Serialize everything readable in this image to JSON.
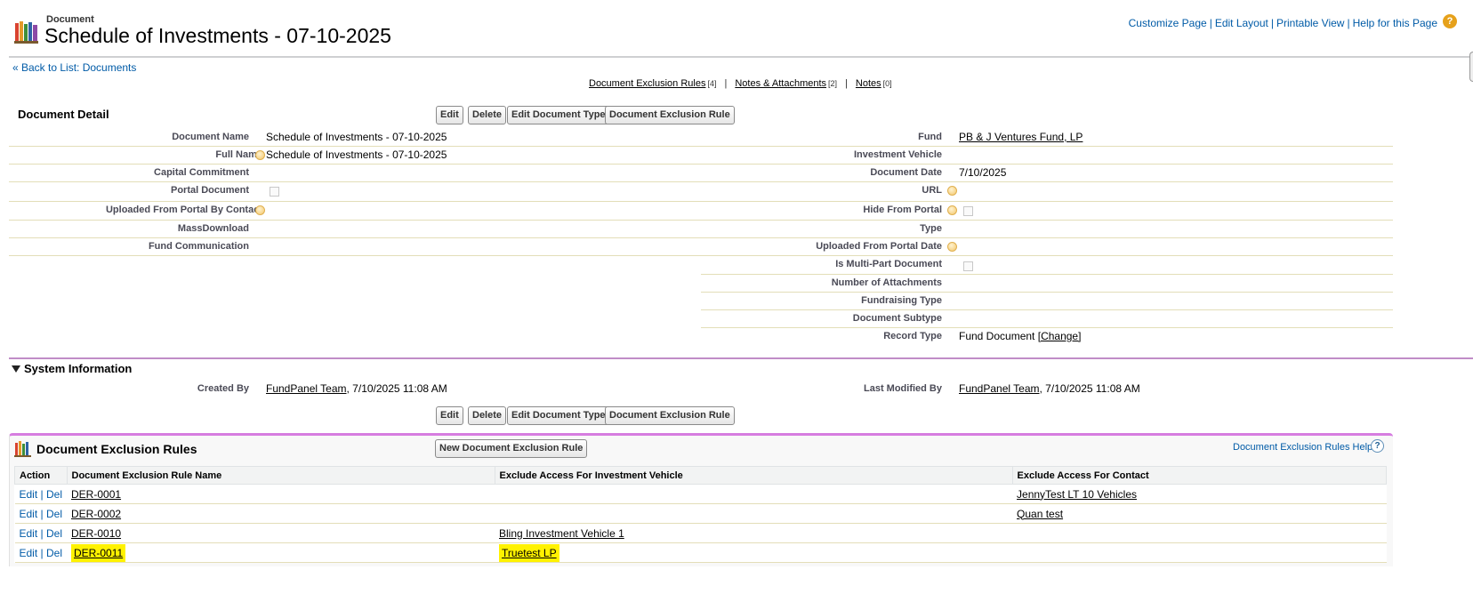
{
  "header": {
    "object_type": "Document",
    "title": "Schedule of Investments - 07-10-2025",
    "links": [
      "Customize Page",
      "Edit Layout",
      "Printable View",
      "Help for this Page"
    ]
  },
  "back_link": "« Back to List: Documents",
  "related_links": [
    {
      "label": "Document Exclusion Rules",
      "count": "[4]"
    },
    {
      "label": "Notes & Attachments",
      "count": "[2]"
    },
    {
      "label": "Notes",
      "count": "[0]"
    }
  ],
  "detail": {
    "section_title": "Document Detail",
    "buttons": [
      "Edit",
      "Delete",
      "Edit Document Type",
      "Document Exclusion Rule"
    ],
    "left": [
      {
        "label": "Document Name",
        "value": "Schedule of Investments - 07-10-2025"
      },
      {
        "label": "Full Name",
        "value": "Schedule of Investments - 07-10-2025"
      },
      {
        "label": "Capital Commitment",
        "value": ""
      },
      {
        "label": "Portal Document",
        "value": ""
      },
      {
        "label": "Uploaded From Portal By Contact",
        "value": ""
      },
      {
        "label": "MassDownload",
        "value": ""
      },
      {
        "label": "Fund Communication",
        "value": ""
      }
    ],
    "right": [
      {
        "label": "Fund",
        "value": "PB & J Ventures Fund, LP"
      },
      {
        "label": "Investment Vehicle",
        "value": ""
      },
      {
        "label": "Document Date",
        "value": "7/10/2025"
      },
      {
        "label": "URL",
        "value": ""
      },
      {
        "label": "Hide From Portal",
        "value": ""
      },
      {
        "label": "Type",
        "value": ""
      },
      {
        "label": "Uploaded From Portal Date",
        "value": ""
      },
      {
        "label": "Is Multi-Part Document",
        "value": ""
      },
      {
        "label": "Number of Attachments",
        "value": ""
      },
      {
        "label": "Fundraising Type",
        "value": ""
      },
      {
        "label": "Document Subtype",
        "value": ""
      },
      {
        "label": "Record Type",
        "value": "Fund Document",
        "action": "[Change]"
      }
    ]
  },
  "system": {
    "title": "System Information",
    "created_by_label": "Created By",
    "created_by_user": "FundPanel Team",
    "created_by_date": ", 7/10/2025 11:08 AM",
    "modified_by_label": "Last Modified By",
    "modified_by_user": "FundPanel Team",
    "modified_by_date": ", 7/10/2025 11:08 AM"
  },
  "exclusion_rules": {
    "title": "Document Exclusion Rules",
    "new_button": "New Document Exclusion Rule",
    "help": "Document Exclusion Rules Help",
    "columns": [
      "Action",
      "Document Exclusion Rule Name",
      "Exclude Access For Investment Vehicle",
      "Exclude Access For Contact"
    ],
    "action_edit": "Edit",
    "action_sep": "|",
    "action_del": "Del",
    "rows": [
      {
        "name": "DER-0001",
        "vehicle": "",
        "contact": "JennyTest LT 10 Vehicles",
        "highlight": false
      },
      {
        "name": "DER-0002",
        "vehicle": "",
        "contact": "Quan test",
        "highlight": false
      },
      {
        "name": "DER-0010",
        "vehicle": "Bling Investment Vehicle 1",
        "contact": "",
        "highlight": false
      },
      {
        "name": "DER-0011",
        "vehicle": "Truetest LP",
        "contact": "",
        "highlight": true
      }
    ]
  },
  "colors": {
    "link": "#015ba7",
    "highlight": "#fff200",
    "accent_purple": "#d67de0"
  }
}
